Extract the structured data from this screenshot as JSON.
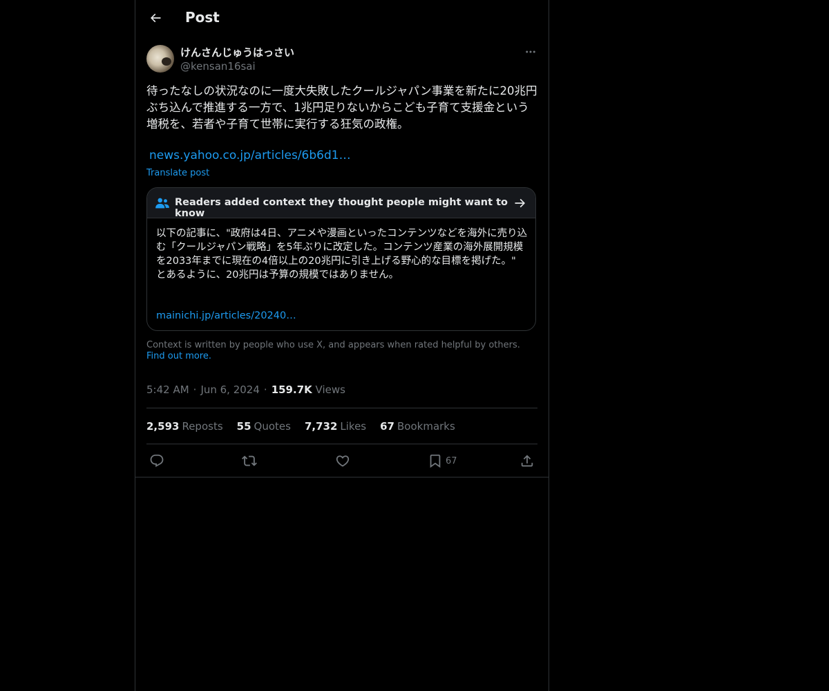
{
  "header": {
    "title": "Post",
    "back_icon": "arrow-left-icon"
  },
  "author": {
    "display_name": "けんさんじゅうはっさい",
    "handle": "@kensan16sai"
  },
  "post": {
    "text": "待ったなしの状況なのに一度大失敗したクールジャパン事業を新たに20兆円ぶち込んで推進する一方で、1兆円足りないからこども子育て支援金という増税を、若者や子育て世帯に実行する狂気の政権。",
    "link": "news.yahoo.co.jp/articles/6b6d1…",
    "translate_label": "Translate post"
  },
  "community_note": {
    "header": "Readers added context they thought people might want to know",
    "body": "以下の記事に、\"政府は4日、アニメや漫画といったコンテンツなどを海外に売り込む「クールジャパン戦略」を5年ぶりに改定した。コンテンツ産業の海外展開規模を2033年までに現在の4倍以上の20兆円に引き上げる野心的な目標を掲げた。\"\nとあるように、20兆円は予算の規模ではありません。",
    "link": "mainichi.jp/articles/20240…",
    "footer_text": "Context is written by people who use X, and appears when rated helpful by others.",
    "find_out_more": "Find out more."
  },
  "meta": {
    "time": "5:42 AM",
    "date": "Jun 6, 2024",
    "views_count": "159.7K",
    "views_label": "Views",
    "separator": "·"
  },
  "stats": {
    "reposts_count": "2,593",
    "reposts_label": "Reposts",
    "quotes_count": "55",
    "quotes_label": "Quotes",
    "likes_count": "7,732",
    "likes_label": "Likes",
    "bookmarks_count": "67",
    "bookmarks_label": "Bookmarks"
  },
  "actions": {
    "bookmark_count": "67",
    "icons": [
      "reply-icon",
      "repost-icon",
      "like-icon",
      "bookmark-icon",
      "share-icon"
    ]
  },
  "colors": {
    "background": "#000000",
    "text": "#e7e9ea",
    "secondary": "#71767b",
    "accent": "#1d9bf0",
    "border": "#2f3336"
  }
}
